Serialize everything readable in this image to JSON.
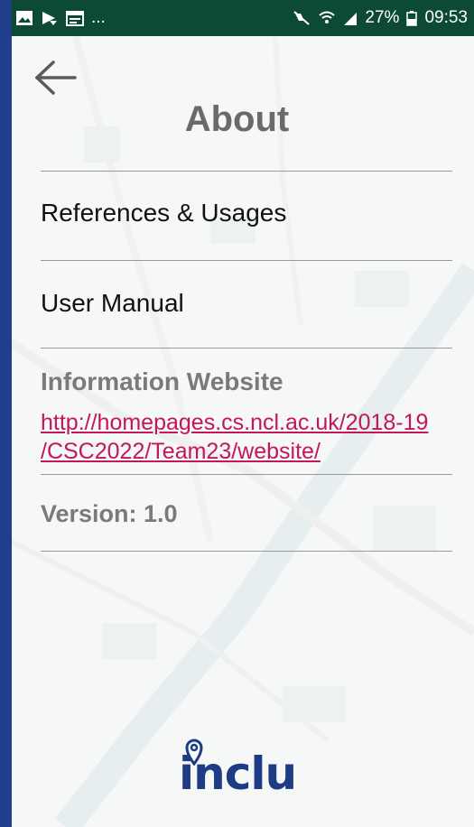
{
  "status_bar": {
    "left_icons": [
      "image-icon",
      "cast-icon",
      "calendar-icon"
    ],
    "overflow": "...",
    "battery_percent": "27%",
    "time": "09:53",
    "bg_color": "#0d4a34"
  },
  "header": {
    "title": "About"
  },
  "menu": {
    "references_label": "References & Usages",
    "user_manual_label": "User Manual"
  },
  "information": {
    "heading": "Information Website",
    "url_line1": "http://homepages.cs.ncl.ac.uk/2018-19",
    "url_line2": "/CSC2022/Team23/website/"
  },
  "version": {
    "label": "Version: 1.0"
  },
  "brand": {
    "logo_text": "inclu",
    "color": "#1d3c84"
  },
  "colors": {
    "link": "#c2185b",
    "heading_gray": "#6a6a6a",
    "frame_blue": "#1f3f8a"
  }
}
